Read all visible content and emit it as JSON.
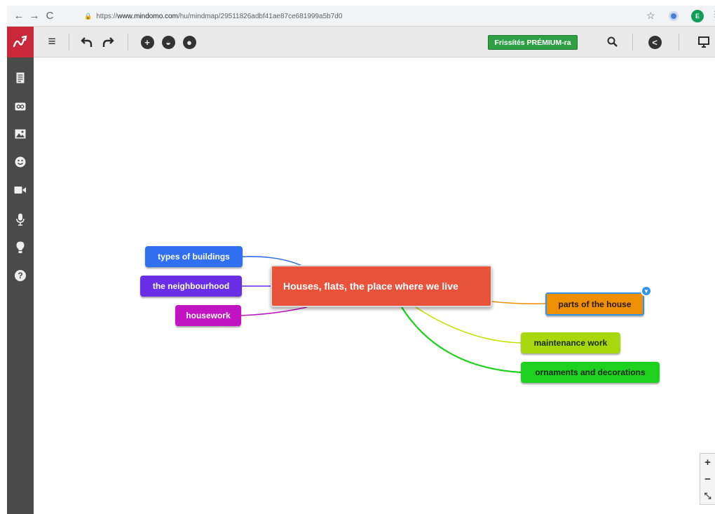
{
  "browser": {
    "url_prefix": "https://",
    "url_host": "www.mindomo.com",
    "url_path": "/hu/mindmap/29511826adbf41ae87ce681999a5b7d0",
    "profile_initial": "E"
  },
  "toolbar": {
    "premium_label": "Frissítés PRÉMIUM-ra",
    "buttons": [
      "menu-icon",
      "undo-icon",
      "redo-icon",
      "add-topic-icon",
      "theme-icon",
      "palette-icon",
      "search-icon",
      "share-icon",
      "present-icon"
    ]
  },
  "sidebar": {
    "items": [
      "notes-icon",
      "link-icon",
      "image-icon",
      "emoji-icon",
      "video-icon",
      "microphone-icon",
      "lightbulb-icon",
      "help-icon"
    ]
  },
  "mindmap": {
    "central": "Houses, flats, the place where we live",
    "left_topics": [
      "types of buildings",
      "the neighbourhood",
      "housework"
    ],
    "right_topics": [
      "parts of the house",
      "maintenance work",
      "ornaments and decorations"
    ],
    "colors": {
      "central": "#e8523a",
      "types": "#2f6ff0",
      "neighbourhood": "#6a2ee6",
      "housework": "#c214c2",
      "parts": "#ef8f06",
      "maintenance": "#a6d80d",
      "ornaments": "#1fd11f",
      "selection": "#2f93e8"
    }
  },
  "zoom": {
    "in": "+",
    "out": "−",
    "fit": "⤡"
  }
}
